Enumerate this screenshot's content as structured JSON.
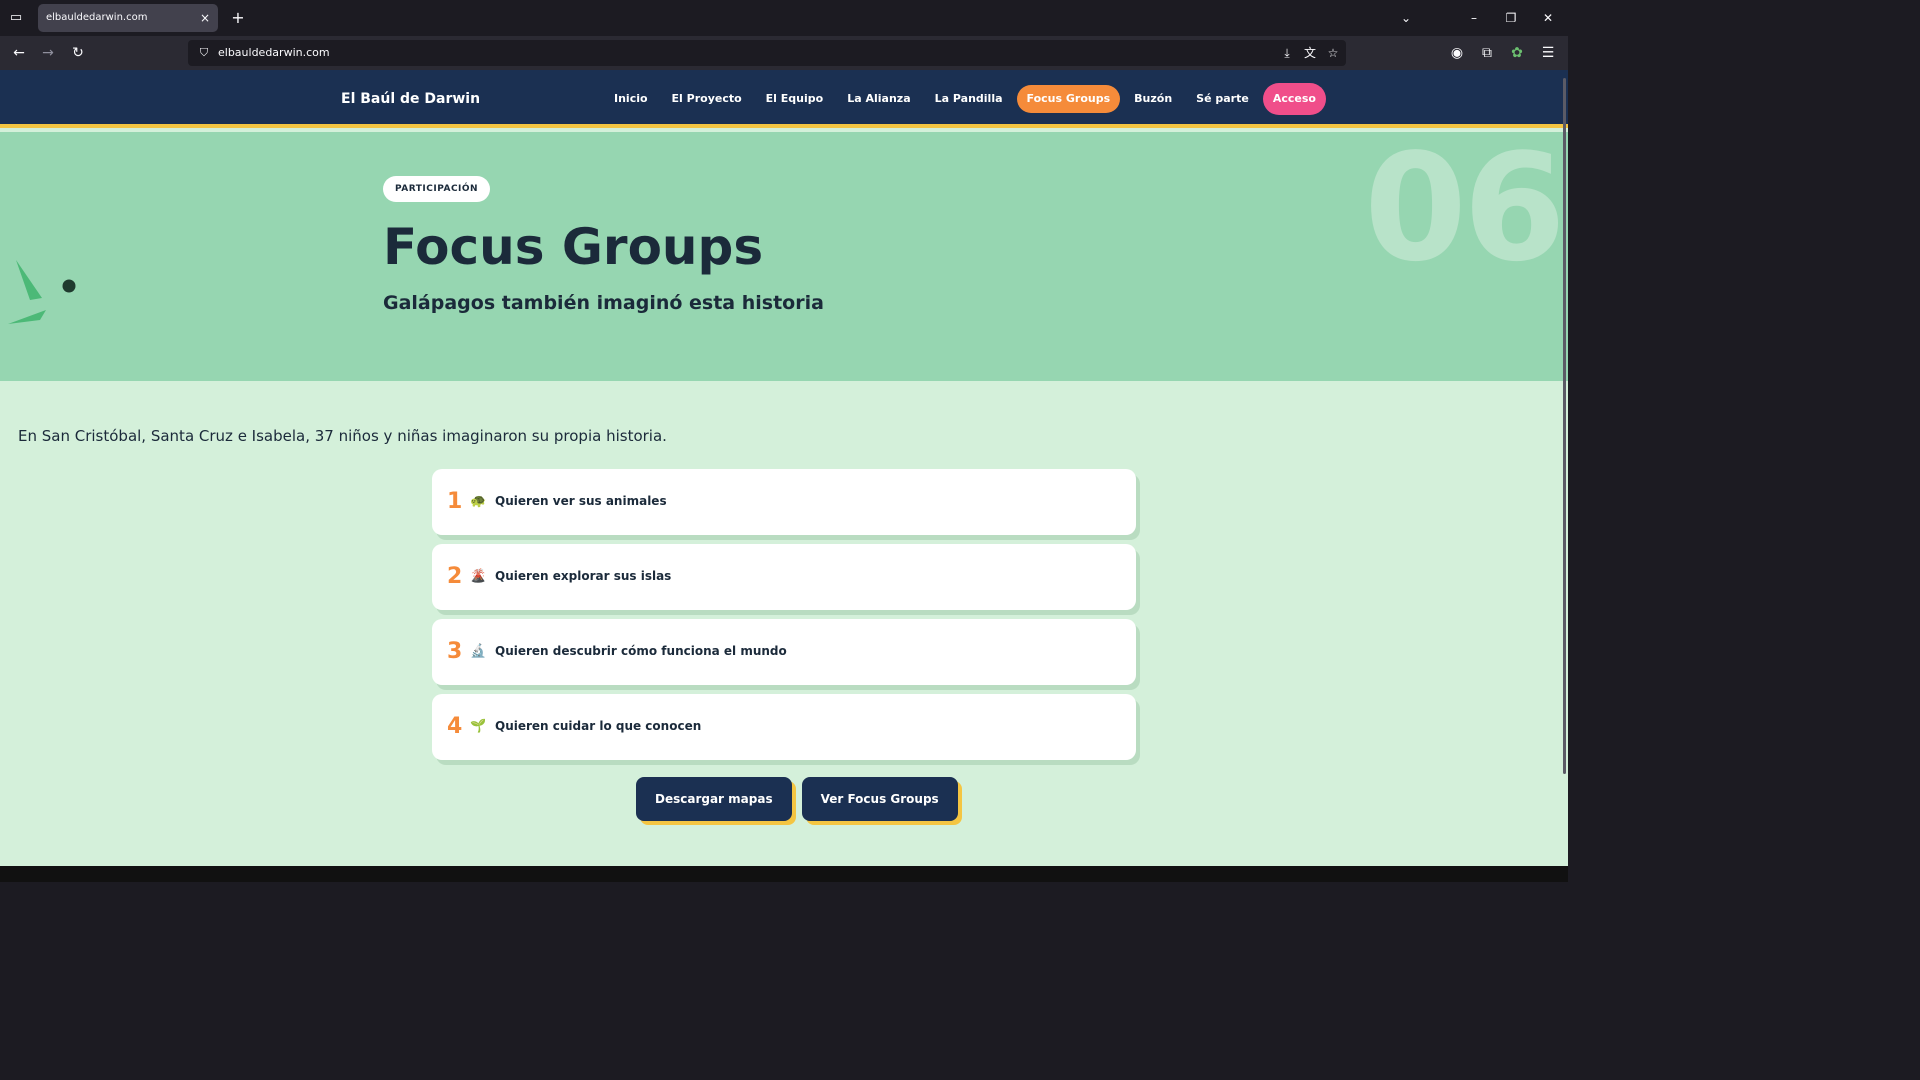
{
  "browser": {
    "tab_title": "elbauldedarwin.com",
    "tab_close": "×",
    "new_tab": "+",
    "url": "elbauldedarwin.com",
    "controls": {
      "list": "⌄",
      "minimize": "–",
      "restore": "❐",
      "close": "✕"
    }
  },
  "site": {
    "brand": "El Baúl de Darwin",
    "menu": [
      {
        "label": "Inicio"
      },
      {
        "label": "El Proyecto"
      },
      {
        "label": "El Equipo"
      },
      {
        "label": "La Alianza"
      },
      {
        "label": "La Pandilla"
      },
      {
        "label": "Focus Groups"
      },
      {
        "label": "Buzón"
      },
      {
        "label": "Sé parte"
      },
      {
        "label": "Acceso"
      }
    ]
  },
  "hero": {
    "badge": "PARTICIPACIÓN",
    "title": "Focus Groups",
    "subtitle": "Galápagos también imaginó esta historia",
    "section_number": "06"
  },
  "intro": "En San Cristóbal, Santa Cruz e Isabela, 37 niños y niñas imaginaron su propia historia.",
  "cards": [
    {
      "number": "1",
      "emoji": "🐢",
      "text": "Quieren ver sus animales"
    },
    {
      "number": "2",
      "emoji": "🌋",
      "text": "Quieren explorar sus islas"
    },
    {
      "number": "3",
      "emoji": "🔬",
      "text": "Quieren descubrir cómo funciona el mundo"
    },
    {
      "number": "4",
      "emoji": "🌱",
      "text": "Quieren cuidar lo que conocen"
    }
  ],
  "buttons": {
    "download": "Descargar mapas",
    "view": "Ver Focus Groups"
  },
  "colors": {
    "header_bg": "#1b3052",
    "hero_bg": "#96d6b1",
    "page_bg": "#d4f0da",
    "accent_orange": "#f58b3a",
    "accent_pink": "#f04e8a",
    "accent_yellow": "#f4c542"
  }
}
